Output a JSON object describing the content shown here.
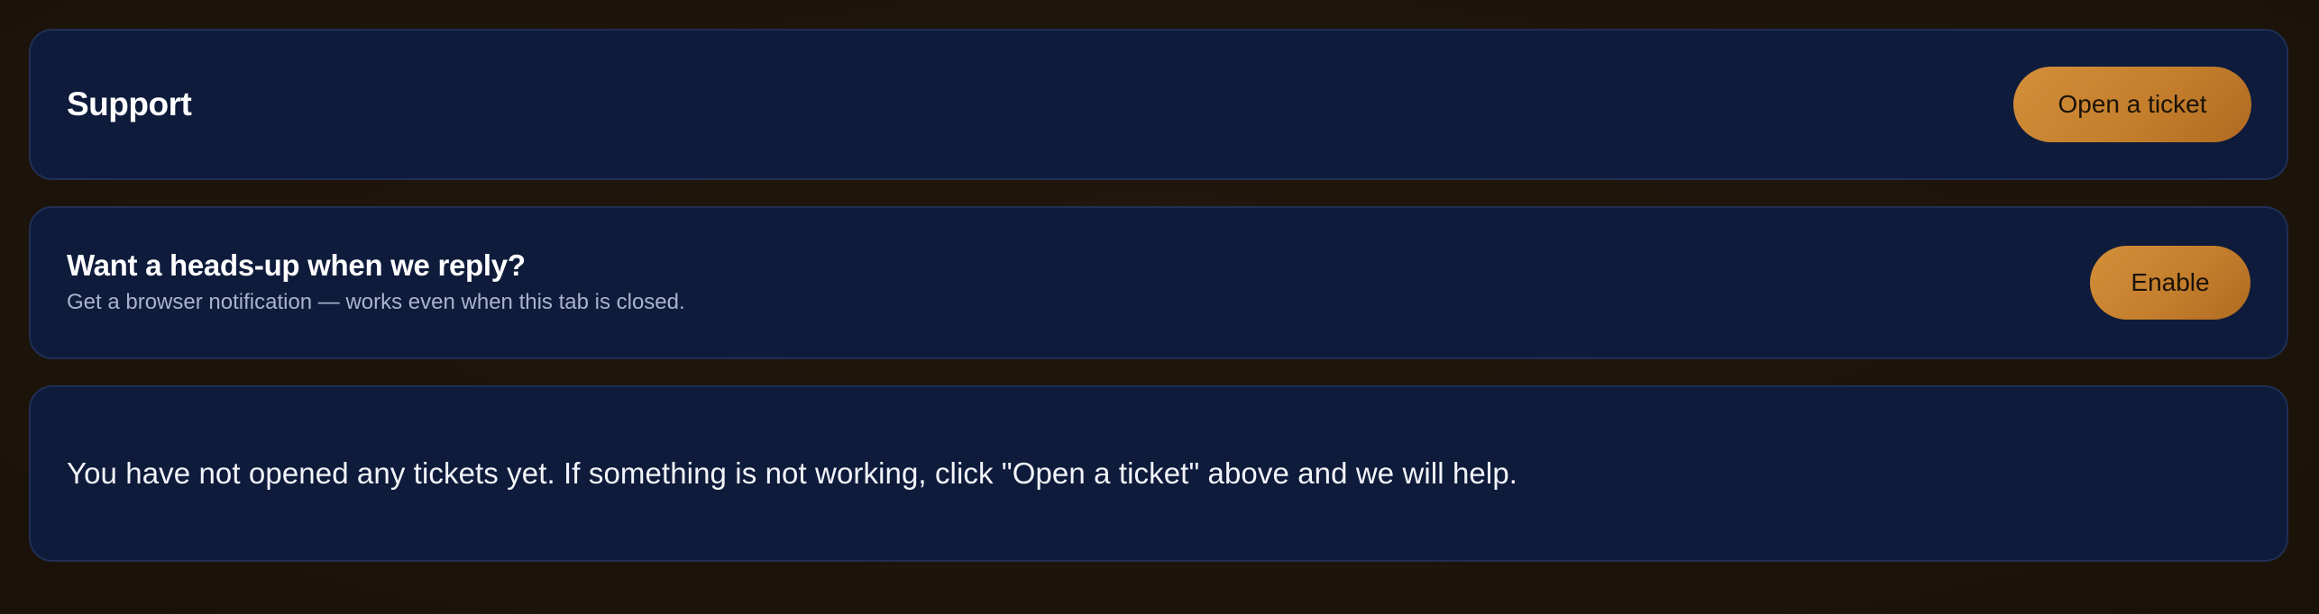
{
  "header": {
    "title": "Support",
    "open_ticket_label": "Open a ticket"
  },
  "notifications": {
    "title": "Want a heads-up when we reply?",
    "subtitle": "Get a browser notification — works even when this tab is closed.",
    "enable_label": "Enable"
  },
  "tickets": {
    "empty_message": "You have not opened any tickets yet. If something is not working, click \"Open a ticket\" above and we will help."
  },
  "colors": {
    "background": "#1f150c",
    "card": "#0e1b3b",
    "card_border": "#1f2f55",
    "accent": "#c98431",
    "text_primary": "#ffffff",
    "text_secondary": "#a9b3cc"
  }
}
